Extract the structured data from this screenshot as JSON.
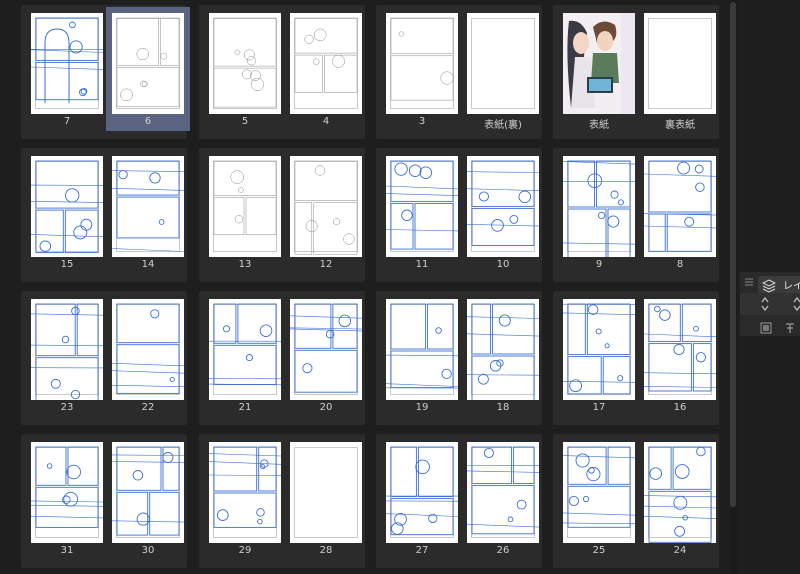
{
  "spreads": [
    {
      "pages": [
        {
          "number": "7"
        },
        {
          "number": "6",
          "selected": true
        }
      ]
    },
    {
      "pages": [
        {
          "number": "5"
        },
        {
          "number": "4"
        }
      ]
    },
    {
      "pages": [
        {
          "number": "3"
        },
        {
          "number": "表紙(裏)"
        }
      ]
    },
    {
      "pages": [
        {
          "number": "表紙",
          "cover": true
        },
        {
          "number": "裏表紙"
        }
      ]
    },
    {
      "pages": [
        {
          "number": "15"
        },
        {
          "number": "14"
        }
      ]
    },
    {
      "pages": [
        {
          "number": "13"
        },
        {
          "number": "12"
        }
      ]
    },
    {
      "pages": [
        {
          "number": "11"
        },
        {
          "number": "10"
        }
      ]
    },
    {
      "pages": [
        {
          "number": "9"
        },
        {
          "number": "8"
        }
      ]
    },
    {
      "pages": [
        {
          "number": "23"
        },
        {
          "number": "22"
        }
      ]
    },
    {
      "pages": [
        {
          "number": "21"
        },
        {
          "number": "20"
        }
      ]
    },
    {
      "pages": [
        {
          "number": "19"
        },
        {
          "number": "18"
        }
      ]
    },
    {
      "pages": [
        {
          "number": "17"
        },
        {
          "number": "16"
        }
      ]
    },
    {
      "pages": [
        {
          "number": "31"
        },
        {
          "number": "30"
        }
      ]
    },
    {
      "pages": [
        {
          "number": "29"
        },
        {
          "number": "28"
        }
      ]
    },
    {
      "pages": [
        {
          "number": "27"
        },
        {
          "number": "26"
        }
      ]
    },
    {
      "pages": [
        {
          "number": "25"
        },
        {
          "number": "24"
        }
      ]
    }
  ],
  "layer_panel": {
    "tab_label": "レイヤ",
    "icon": "layers-icon"
  },
  "colors": {
    "background": "#1e1e1e",
    "spread": "#2b2b2b",
    "selected": "#5a6480",
    "sketch": "#3b6fd6"
  }
}
